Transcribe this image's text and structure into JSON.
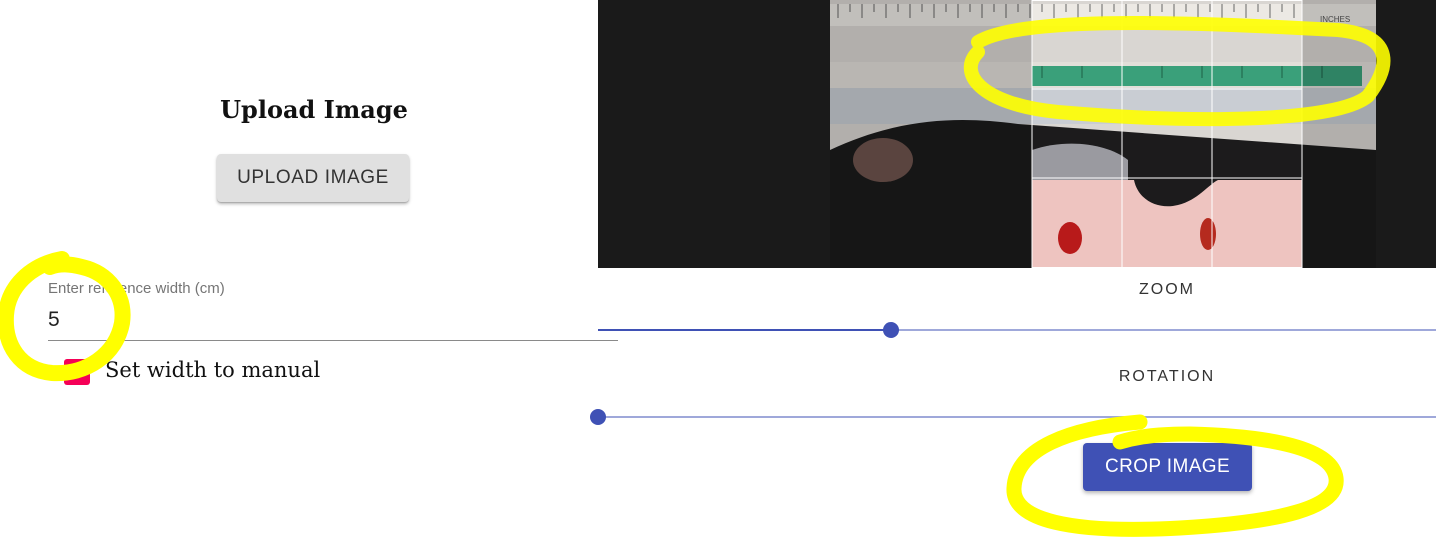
{
  "upload": {
    "heading": "Upload Image",
    "button_label": "UPLOAD IMAGE"
  },
  "reference": {
    "label": "Enter reference width (cm)",
    "value": "5"
  },
  "manual_width": {
    "label": "Set width to manual",
    "checked": true,
    "accent": "#f50057"
  },
  "zoom": {
    "label": "ZOOM",
    "level_fraction": 0.35
  },
  "rotation": {
    "label": "ROTATION",
    "level_fraction": 0.0
  },
  "crop": {
    "button_label": "CROP IMAGE",
    "accent": "#3f51b5"
  },
  "ruler": {
    "header_text": "INCHES"
  },
  "annotation": {
    "highlight_color": "#ffff00"
  }
}
